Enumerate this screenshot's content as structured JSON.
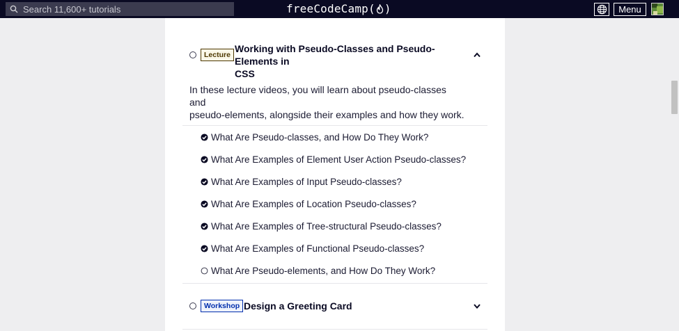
{
  "navbar": {
    "search_placeholder": "Search 11,600+ tutorials",
    "brand_left": "freeCodeCamp(",
    "brand_right": ")",
    "menu_label": "Menu",
    "icons": [
      "search-icon",
      "flame-icon",
      "globe-icon",
      "avatar"
    ]
  },
  "lecture_block": {
    "tag": "Lecture",
    "title_line1": "Working with Pseudo-Classes and Pseudo-Elements in",
    "title_line2": "CSS",
    "expanded": true,
    "description_line1": "In these lecture videos, you will learn about pseudo-classes and",
    "description_line2": "pseudo-elements, alongside their examples and how they work.",
    "steps": [
      {
        "label": "What Are Pseudo-classes, and How Do They Work?",
        "completed": true
      },
      {
        "label": "What Are Examples of Element User Action Pseudo-classes?",
        "completed": true
      },
      {
        "label": "What Are Examples of Input Pseudo-classes?",
        "completed": true
      },
      {
        "label": "What Are Examples of Location Pseudo-classes?",
        "completed": true
      },
      {
        "label": "What Are Examples of Tree-structural Pseudo-classes?",
        "completed": true
      },
      {
        "label": "What Are Examples of Functional Pseudo-classes?",
        "completed": true
      },
      {
        "label": "What Are Pseudo-elements, and How Do They Work?",
        "completed": false
      }
    ]
  },
  "workshop_block": {
    "tag": "Workshop",
    "title": "Design a Greeting Card",
    "expanded": false
  },
  "colors": {
    "nav_bg": "#0a0a23",
    "lecture_tag": "#4d3800",
    "workshop_tag": "#002ead",
    "page_bg": "#eeeef0"
  }
}
